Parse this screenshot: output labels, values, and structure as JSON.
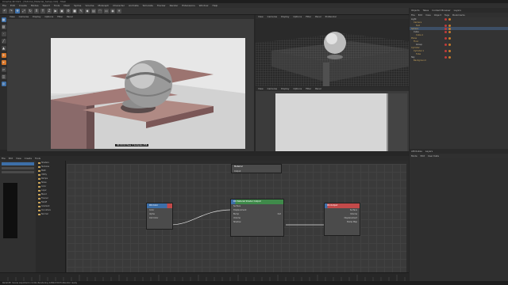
{
  "app": {
    "title": "Cinema 4D R21 - [Tutorial_Material_Setup.c4d] - Main"
  },
  "menu": [
    "File",
    "Edit",
    "Create",
    "Modes",
    "Select",
    "Tools",
    "Mesh",
    "Spline",
    "Volume",
    "MoGraph",
    "Character",
    "Animate",
    "Simulate",
    "Tracker",
    "Render",
    "Extensions",
    "Window",
    "Help"
  ],
  "viewport_main": {
    "menu": [
      "View",
      "Cameras",
      "Display",
      "Options",
      "Filter",
      "Panel"
    ],
    "status": "00:00:02  Pass 3  Samples 256"
  },
  "viewport_persp": {
    "menu": [
      "View",
      "Cameras",
      "Display",
      "Options",
      "Filter",
      "Panel",
      "ProRender"
    ]
  },
  "viewport_front": {
    "menu": [
      "View",
      "Cameras",
      "Display",
      "Options",
      "Filter",
      "Panel"
    ]
  },
  "object_manager": {
    "tabs": [
      "Objects",
      "Takes",
      "Content Browser",
      "Layers"
    ],
    "menu": [
      "File",
      "Edit",
      "View",
      "Object",
      "Tags",
      "Bookmarks"
    ],
    "rows": [
      {
        "name": "Light",
        "hl": false
      },
      {
        "name": "Camera",
        "hl": false
      },
      {
        "name": "Null",
        "hl": false
      },
      {
        "name": "Sphere",
        "hl": true
      },
      {
        "name": "Cube",
        "hl": false
      },
      {
        "name": "Cube.1",
        "hl": false
      },
      {
        "name": "Plane",
        "hl": false
      },
      {
        "name": "Floor",
        "hl": false
      },
      {
        "name": "Group",
        "hl": false
      },
      {
        "name": "Cylinder",
        "hl": false
      },
      {
        "name": "Cylinder.1",
        "hl": false
      },
      {
        "name": "Tube",
        "hl": false
      },
      {
        "name": "Sky",
        "hl": false
      },
      {
        "name": "Background",
        "hl": false
      }
    ]
  },
  "attribute_manager": {
    "tabs": [
      "Attributes",
      "Layers"
    ],
    "menu": [
      "Mode",
      "Edit",
      "User Data"
    ]
  },
  "node_editor": {
    "title": "Node Editor",
    "menu": [
      "File",
      "Edit",
      "View",
      "Create",
      "Tools"
    ],
    "tree_items": [
      "Shaders",
      "Textures",
      "Math",
      "Utility",
      "Ramps",
      "Noise",
      "Color",
      "Layer",
      "Blend",
      "Fresnel",
      "Falloff",
      "Gradient",
      "Curvature",
      "Normal"
    ],
    "nodes": {
      "source": {
        "title": "RS Color",
        "ports": [
          "Color",
          "Alpha",
          "Out Color"
        ]
      },
      "material": {
        "title": "RS Material Shader Output",
        "ports": [
          "Surface",
          "Displacement",
          "Bump",
          "Out",
          "Volume",
          "Shadow"
        ]
      },
      "output": {
        "title": "RS Output",
        "ports": [
          "Surface",
          "Volume",
          "Displacement",
          "Bump Map"
        ]
      },
      "top": {
        "title": "Material",
        "ports": [
          "Output"
        ]
      }
    }
  },
  "status_bar": {
    "text": "Redshift: Scene exported in 0.02s  Rendering 1280x720  ProRender ready"
  }
}
